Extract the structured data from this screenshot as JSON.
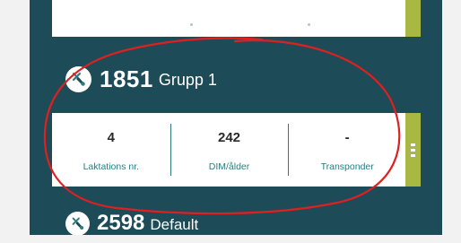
{
  "animals": [
    {
      "number": "1851",
      "group": "Grupp 1",
      "stats": [
        {
          "value": "4",
          "label": "Laktations nr."
        },
        {
          "value": "242",
          "label": "DIM/ålder"
        },
        {
          "value": "-",
          "label": "Transponder"
        }
      ]
    },
    {
      "number": "2598",
      "group": "Default"
    }
  ],
  "icons": {
    "animal": "cow-tag-icon",
    "menu": "more-vertical-icon"
  },
  "colors": {
    "background": "#1d4b57",
    "accent": "#a8b843",
    "label": "#2b7d80",
    "annotation": "#e02020"
  }
}
